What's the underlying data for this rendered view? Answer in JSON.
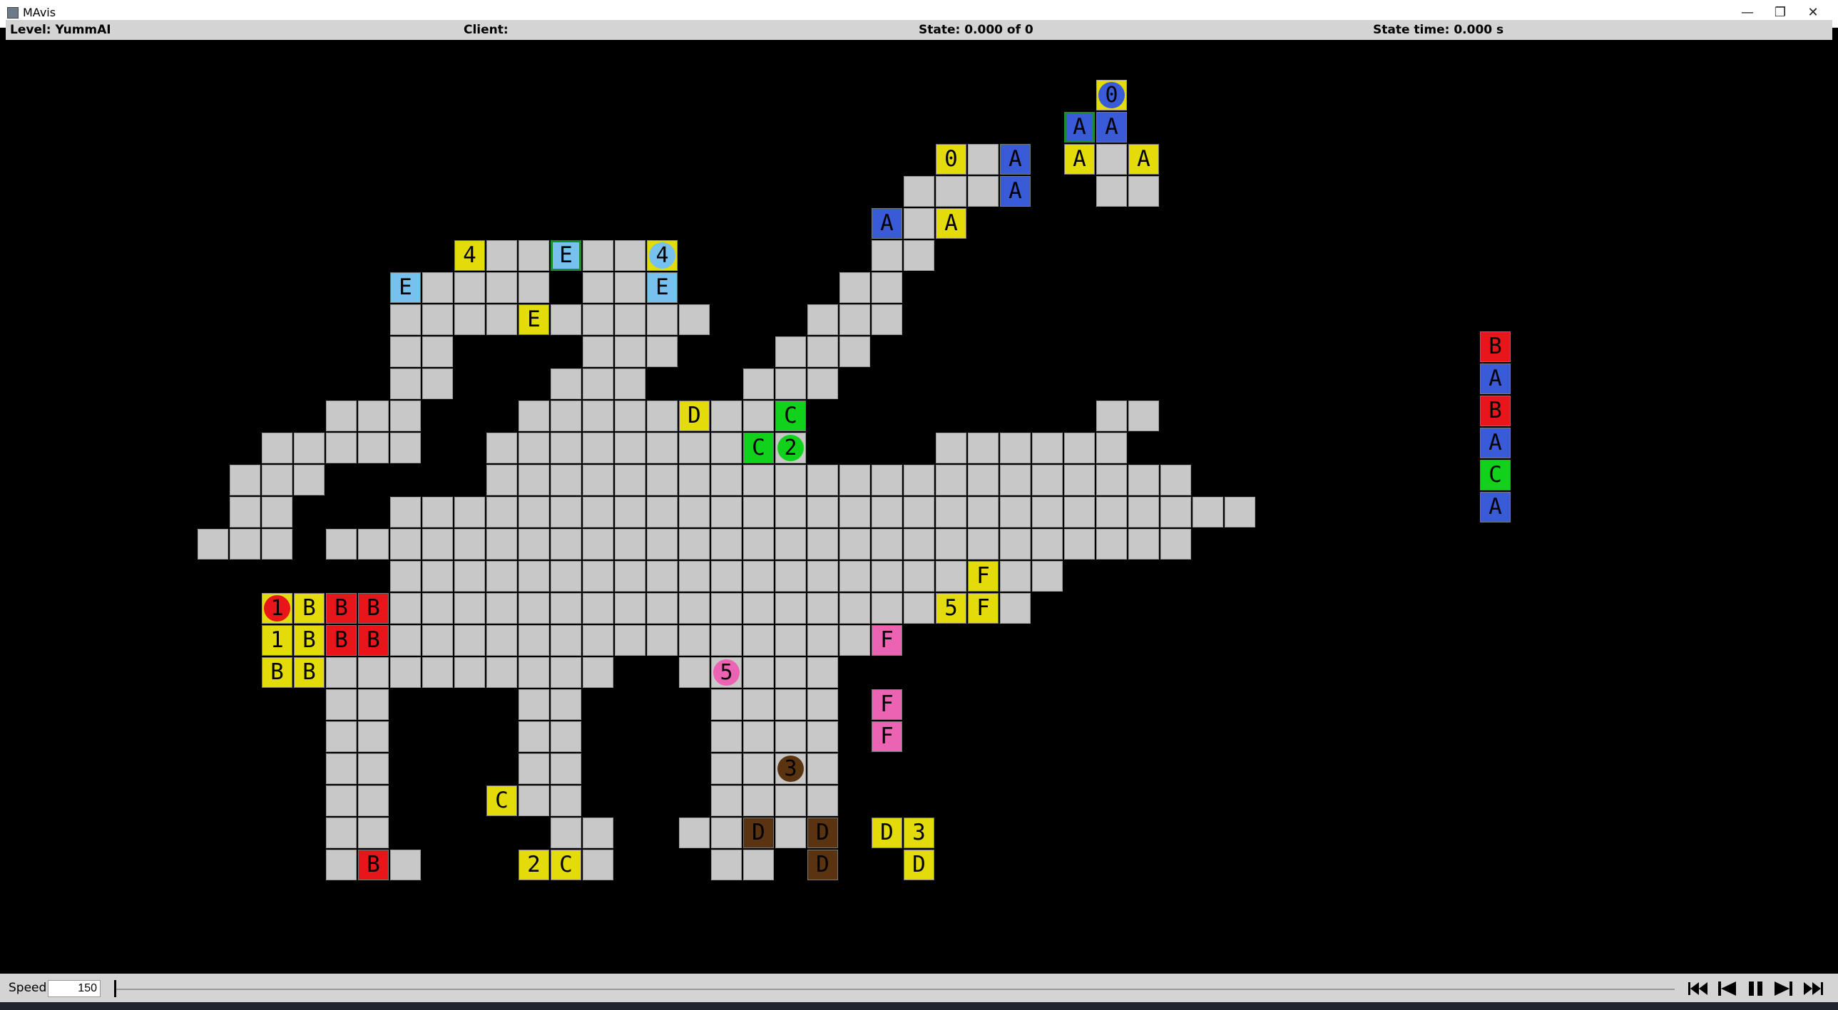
{
  "window": {
    "title": "MAvis",
    "buttons": {
      "minimize": "—",
      "restore": "❐",
      "close": "✕"
    }
  },
  "status": {
    "level": "Level: YummAI",
    "client": "Client:",
    "state": "State: 0.000 of 0",
    "state_time": "State time: 0.000 s"
  },
  "controls": {
    "speed_label": "Speed:",
    "speed_value": "150",
    "seek_position": 0
  },
  "colors": {
    "yellow": "#e4dc0a",
    "blue": "#3a5bd8",
    "red": "#e8151a",
    "green": "#11d11a",
    "lightblue": "#76c1ee",
    "pink": "#ec63b4",
    "brown": "#5a3410",
    "floor": "#c8c8c8",
    "background": "#000000"
  },
  "grid_rows": [
    "...........................................",
    "...........................................",
    "..................................0........",
    ".................................GA........",
    "..............................0A.YAY.......",
    "............................__A...__.......",
    "...........................A_Y.............",
    "..............4__E__4......__..............",
    "............E____.__E.....__...............",
    "............____E_____...___...............",
    "............__....___...___................",
    "............__...___...___.................",
    "..........___...____D__C..........__.......",
    "........_____..______CC......______........",
    ".......___.....______________________......",
    ".......__...___________________________....",
    "......___.___________________________......",
    "............____________________F..........",
    "........1BBB__________________5F...........",
    "........1BBB_______________F...............",
    "........BB_________..5____.................",
    "..........__....__....___F.................",
    "..........__....__....___F.................",
    "..........__....__....3___.................",
    "..........__....C_....____.................",
    "..........__.....__..D_DD3.................",
    "..........__B....2C...__.D.................",
    "..........................................."
  ],
  "boxes": [
    {
      "r": 3,
      "c": 33,
      "letter": "A",
      "color": "blue",
      "border": "green"
    },
    {
      "r": 3,
      "c": 34,
      "letter": "A",
      "color": "blue"
    },
    {
      "r": 4,
      "c": 31,
      "letter": "A",
      "color": "blue"
    },
    {
      "r": 4,
      "c": 33,
      "letter": "A",
      "color": "yellow"
    },
    {
      "r": 4,
      "c": 35,
      "letter": "A",
      "color": "yellow"
    },
    {
      "r": 5,
      "c": 31,
      "letter": "A",
      "color": "blue"
    },
    {
      "r": 6,
      "c": 27,
      "letter": "A",
      "color": "blue"
    },
    {
      "r": 6,
      "c": 29,
      "letter": "A",
      "color": "yellow"
    },
    {
      "r": 7,
      "c": 17,
      "letter": "E",
      "color": "lightblue",
      "border": "green"
    },
    {
      "r": 8,
      "c": 12,
      "letter": "E",
      "color": "lightblue"
    },
    {
      "r": 8,
      "c": 20,
      "letter": "E",
      "color": "lightblue"
    },
    {
      "r": 9,
      "c": 16,
      "letter": "E",
      "color": "yellow"
    },
    {
      "r": 12,
      "c": 21,
      "letter": "D",
      "color": "yellow"
    },
    {
      "r": 12,
      "c": 24,
      "letter": "C",
      "color": "green"
    },
    {
      "r": 13,
      "c": 23,
      "letter": "C",
      "color": "green"
    },
    {
      "r": 17,
      "c": 30,
      "letter": "F",
      "color": "yellow"
    },
    {
      "r": 18,
      "c": 9,
      "letter": "B",
      "color": "yellow"
    },
    {
      "r": 18,
      "c": 10,
      "letter": "B",
      "color": "red"
    },
    {
      "r": 18,
      "c": 11,
      "letter": "B",
      "color": "red"
    },
    {
      "r": 18,
      "c": 30,
      "letter": "F",
      "color": "yellow"
    },
    {
      "r": 19,
      "c": 9,
      "letter": "B",
      "color": "yellow"
    },
    {
      "r": 19,
      "c": 10,
      "letter": "B",
      "color": "red"
    },
    {
      "r": 19,
      "c": 11,
      "letter": "B",
      "color": "red"
    },
    {
      "r": 19,
      "c": 27,
      "letter": "F",
      "color": "pink"
    },
    {
      "r": 20,
      "c": 8,
      "letter": "B",
      "color": "yellow"
    },
    {
      "r": 20,
      "c": 9,
      "letter": "B",
      "color": "yellow"
    },
    {
      "r": 21,
      "c": 27,
      "letter": "F",
      "color": "pink"
    },
    {
      "r": 22,
      "c": 27,
      "letter": "F",
      "color": "pink"
    },
    {
      "r": 24,
      "c": 15,
      "letter": "C",
      "color": "yellow"
    },
    {
      "r": 25,
      "c": 23,
      "letter": "D",
      "color": "brown"
    },
    {
      "r": 25,
      "c": 25,
      "letter": "D",
      "color": "brown"
    },
    {
      "r": 25,
      "c": 27,
      "letter": "D",
      "color": "yellow"
    },
    {
      "r": 26,
      "c": 11,
      "letter": "B",
      "color": "red"
    },
    {
      "r": 26,
      "c": 17,
      "letter": "C",
      "color": "yellow"
    },
    {
      "r": 26,
      "c": 25,
      "letter": "D",
      "color": "brown"
    },
    {
      "r": 26,
      "c": 28,
      "letter": "D",
      "color": "yellow"
    }
  ],
  "goal_numbers": [
    {
      "r": 4,
      "c": 29,
      "label": "0",
      "color": "yellow"
    },
    {
      "r": 7,
      "c": 14,
      "label": "4",
      "color": "yellow"
    },
    {
      "r": 19,
      "c": 8,
      "label": "1",
      "color": "yellow"
    },
    {
      "r": 18,
      "c": 29,
      "label": "5",
      "color": "yellow"
    },
    {
      "r": 25,
      "c": 28,
      "label": "3",
      "color": "yellow"
    },
    {
      "r": 26,
      "c": 16,
      "label": "2",
      "color": "yellow"
    }
  ],
  "agents": [
    {
      "r": 2,
      "c": 34,
      "label": "0",
      "color": "blue",
      "cell": "yellow"
    },
    {
      "r": 7,
      "c": 20,
      "label": "4",
      "color": "lightblue",
      "cell": "yellow"
    },
    {
      "r": 13,
      "c": 24,
      "label": "2",
      "color": "green",
      "cell": "floor"
    },
    {
      "r": 18,
      "c": 8,
      "label": "1",
      "color": "red",
      "cell": "yellow"
    },
    {
      "r": 20,
      "c": 22,
      "label": "5",
      "color": "pink",
      "cell": "floor"
    },
    {
      "r": 23,
      "c": 24,
      "label": "3",
      "color": "brown",
      "cell": "floor"
    }
  ],
  "legend": [
    {
      "letter": "B",
      "color": "red"
    },
    {
      "letter": "A",
      "color": "blue"
    },
    {
      "letter": "B",
      "color": "red"
    },
    {
      "letter": "A",
      "color": "blue"
    },
    {
      "letter": "C",
      "color": "green"
    },
    {
      "letter": "A",
      "color": "blue"
    }
  ]
}
